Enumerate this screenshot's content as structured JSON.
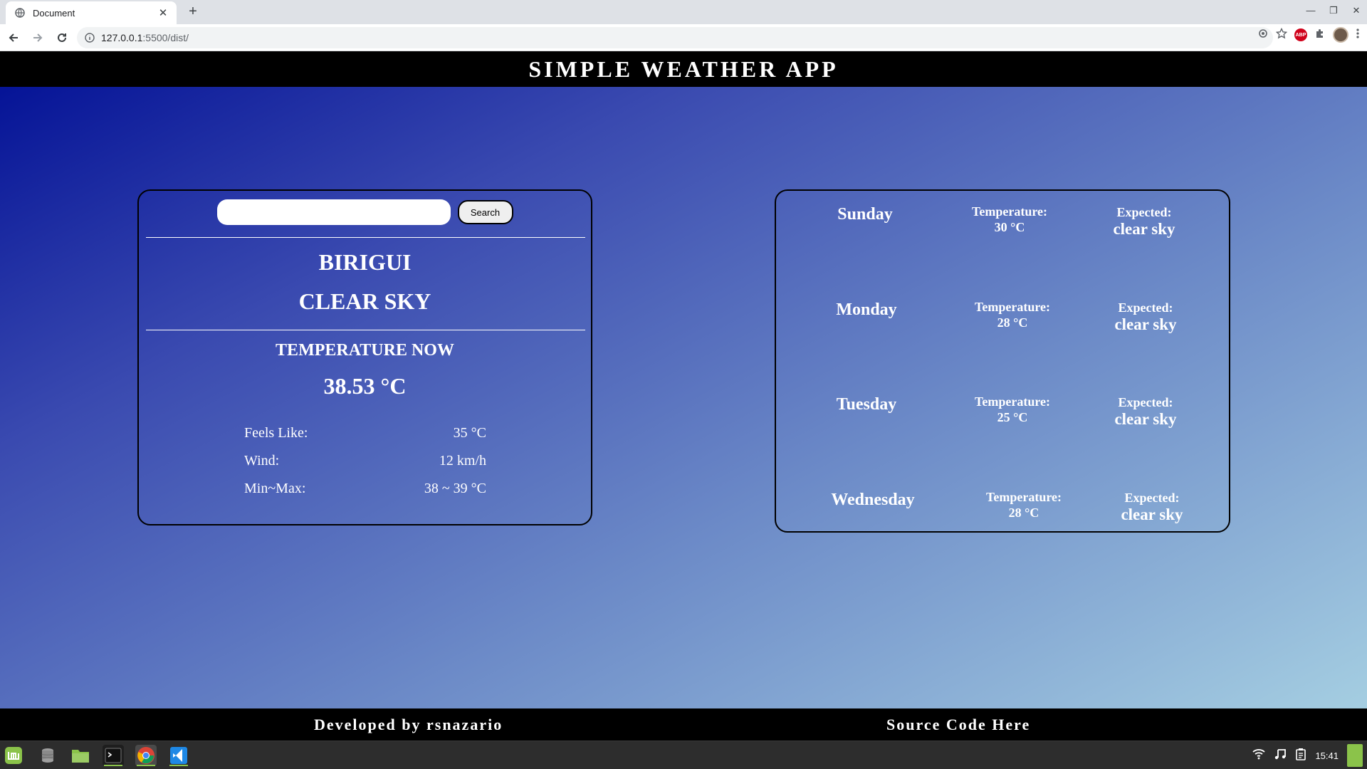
{
  "browser": {
    "tab_title": "Document",
    "url_host": "127.0.0.1",
    "url_path": ":5500/dist/",
    "new_tab_label": "+"
  },
  "app": {
    "title": "SIMPLE WEATHER APP",
    "search": {
      "value": "",
      "placeholder": "",
      "button_label": "Search"
    },
    "current": {
      "city": "BIRIGUI",
      "condition": "CLEAR SKY",
      "temp_label": "TEMPERATURE NOW",
      "temp_value": "38.53  °C",
      "details": [
        {
          "label": "Feels Like:",
          "value": "35  °C"
        },
        {
          "label": "Wind:",
          "value": "12  km/h"
        },
        {
          "label": "Min~Max:",
          "value": "38 ~ 39  °C"
        }
      ]
    },
    "forecast": [
      {
        "day": "Sunday",
        "temp_label": "Temperature:",
        "temp_value": "30  °C",
        "expected_label": "Expected:",
        "expected_value": "clear sky"
      },
      {
        "day": "Monday",
        "temp_label": "Temperature:",
        "temp_value": "28  °C",
        "expected_label": "Expected:",
        "expected_value": "clear sky"
      },
      {
        "day": "Tuesday",
        "temp_label": "Temperature:",
        "temp_value": "25  °C",
        "expected_label": "Expected:",
        "expected_value": "clear sky"
      },
      {
        "day": "Wednesday",
        "temp_label": "Temperature:",
        "temp_value": "28  °C",
        "expected_label": "Expected:",
        "expected_value": "clear sky"
      }
    ],
    "footer": {
      "developer": "Developed by rsnazario",
      "source": "Source Code Here"
    }
  },
  "taskbar": {
    "apps": [
      "mint-menu-icon",
      "files-db-icon",
      "folder-icon",
      "terminal-icon",
      "chrome-icon",
      "vscode-icon"
    ],
    "clock": "15:41"
  },
  "colors": {
    "gradient_start": "#000e94",
    "gradient_end": "#a8d2e3",
    "header_bg": "#000000",
    "accent_green": "#8bc34a"
  }
}
